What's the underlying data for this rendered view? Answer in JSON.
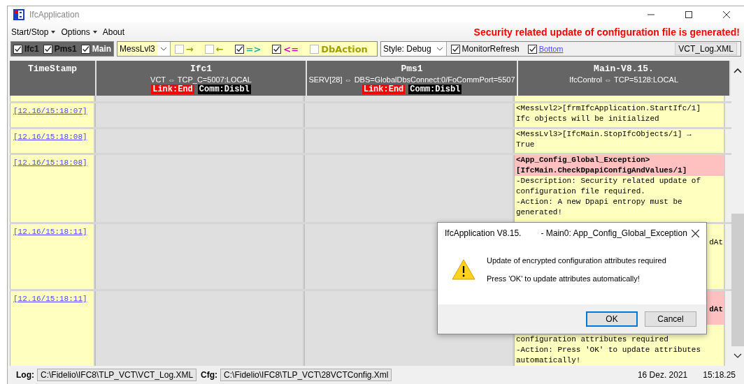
{
  "window": {
    "title": "IfcApplication"
  },
  "menu": [
    {
      "label": "Start/Stop",
      "dropdown": true
    },
    {
      "label": "Options",
      "dropdown": true
    },
    {
      "label": "About",
      "dropdown": false
    }
  ],
  "alert": "Security related update of configuration file is generated!",
  "toolbar": {
    "interfaces": [
      {
        "label": "Ifc1",
        "checked": true
      },
      {
        "label": "Pms1",
        "checked": true
      },
      {
        "label": "Main",
        "checked": true
      }
    ],
    "level": "MessLvl3",
    "filters": [
      {
        "label": "→",
        "checked": false,
        "color": "#a0a000"
      },
      {
        "label": "←",
        "checked": false,
        "color": "#a0a000"
      },
      {
        "label": "=>",
        "checked": true,
        "color": "#20b0a0"
      },
      {
        "label": "<=",
        "checked": true,
        "color": "#d000c0"
      },
      {
        "label": "DbAction",
        "checked": false,
        "color": "#a0a000"
      }
    ],
    "style": "Style: Debug",
    "monitor_refresh": {
      "label": "MonitorRefresh",
      "checked": true
    },
    "bottom": {
      "label": "Bottom",
      "checked": true
    },
    "log_file": "VCT_Log.XML"
  },
  "columns": [
    {
      "title": "TimeStamp"
    },
    {
      "title": "Ifc1",
      "subtitle": "VCT ⇔ TCP_C=5007:LOCAL",
      "badges": [
        {
          "text": "Link:End",
          "color": "#ff0000"
        },
        {
          "text": "Comm:Disbl",
          "color": "#000000"
        }
      ]
    },
    {
      "title": "Pms1",
      "subtitle": "SERV[28] ⇔ DBS=GlobalDbsConnect:0/FoCommPort=5507",
      "badges": [
        {
          "text": "Link:End",
          "color": "#ff0000"
        },
        {
          "text": "Comm:Disbl",
          "color": "#000000"
        }
      ]
    },
    {
      "title": "Main-V8.15.",
      "subtitle": "IfcControl ⇔ TCP=5128:LOCAL"
    }
  ],
  "rows": [
    {
      "timestamp": "[12.16/15:18:07]",
      "main": [
        {
          "kind": "info",
          "text": "<MessLvl2>[frmIfcApplication.StartIfc/1]\nIfc objects will be initialized"
        }
      ]
    },
    {
      "timestamp": "[12.16/15:18:08]",
      "main": [
        {
          "kind": "info",
          "text": "<MessLvl3>[IfcMain.StopIfcObjects/1] →\nTrue"
        }
      ]
    },
    {
      "timestamp": "[12.16/15:18:08]",
      "main": [
        {
          "kind": "error",
          "text": "<App_Config_Global_Exception>\n[IfcMain.CheckDpapiConfigAndValues/1]"
        },
        {
          "kind": "info",
          "text": "-Description: Security related update of\nconfiguration file required.\n-Action: A new Dpapi entropy must be\ngenerated!"
        }
      ]
    },
    {
      "timestamp": "[12.16/15:18:11]",
      "main": [
        {
          "kind": "tail",
          "text": "dAt"
        }
      ]
    },
    {
      "timestamp": "[12.16/15:18:11]",
      "main": [
        {
          "kind": "errortail",
          "text": "dAt"
        },
        {
          "kind": "hidden"
        },
        {
          "kind": "info",
          "text": "configuration attributes required\n-Action: Press 'OK' to update attributes\nautomatically!"
        }
      ]
    }
  ],
  "status_bar": {
    "log_label": "Log:",
    "log_path": "C:\\Fidelio\\IFC8\\TLP_VCT\\VCT_Log.XML",
    "cfg_label": "Cfg:",
    "cfg_path": "C:\\Fidelio\\IFC8\\TLP_VCT\\28VCTConfig.Xml",
    "date": "16 Dez. 2021",
    "time": "15:18.25"
  },
  "dialog": {
    "title": "IfcApplication V8.15.",
    "title_tail": "- Main0: App_Config_Global_Exception",
    "message": "Update of encrypted configuration attributes required",
    "hint": "Press 'OK' to update attributes automatically!",
    "buttons": [
      {
        "label": "OK",
        "selected": true
      },
      {
        "label": "Cancel",
        "selected": false
      }
    ]
  }
}
